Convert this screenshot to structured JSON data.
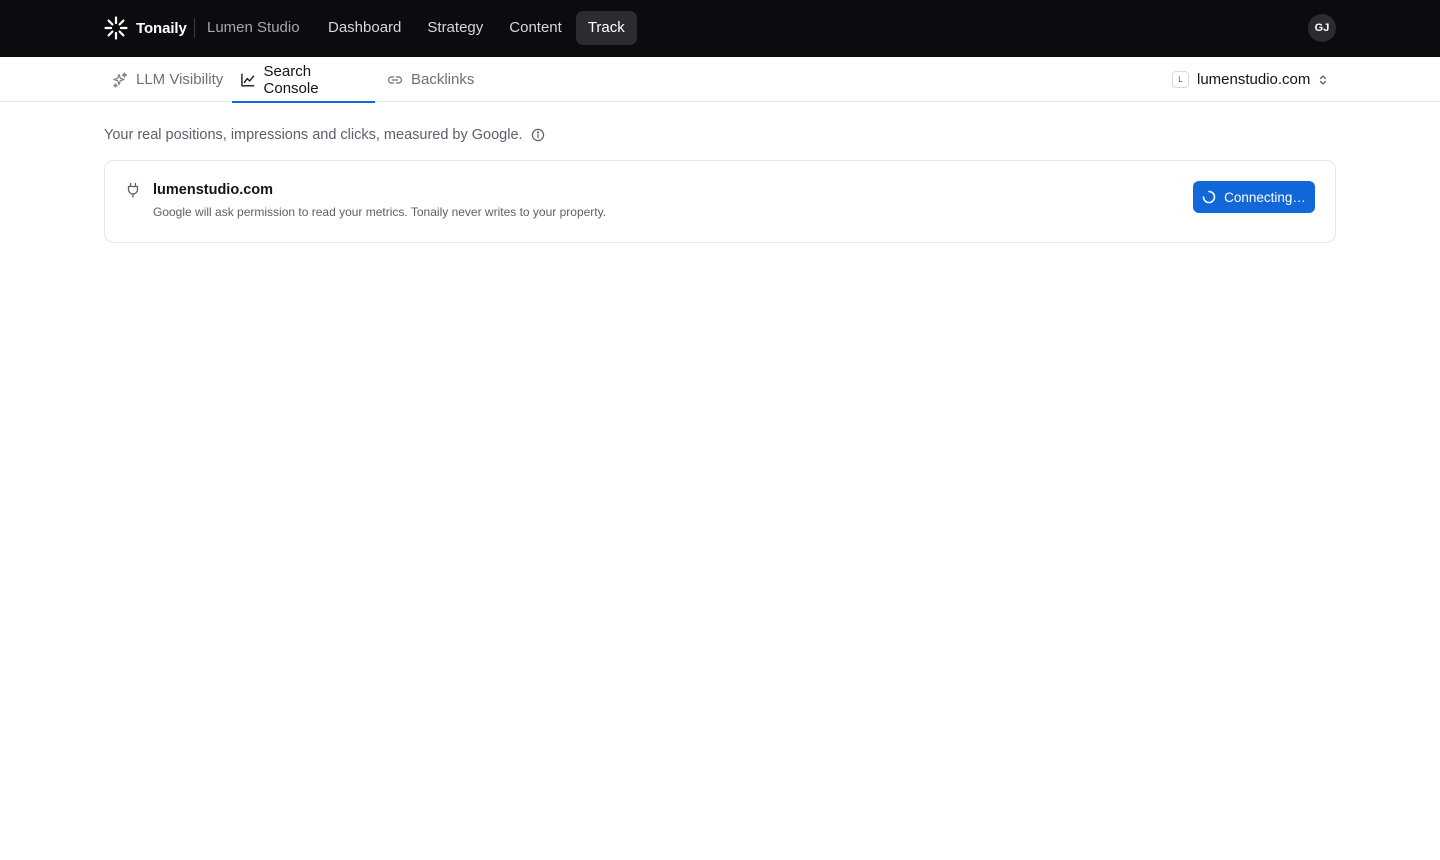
{
  "app": {
    "brand": "Tonaily",
    "workspace": "Lumen Studio",
    "user_initials": "GJ"
  },
  "nav": [
    {
      "label": "Dashboard",
      "active": false
    },
    {
      "label": "Strategy",
      "active": false
    },
    {
      "label": "Content",
      "active": false
    },
    {
      "label": "Track",
      "active": true
    }
  ],
  "subnav": {
    "tabs": [
      {
        "label": "LLM Visibility",
        "icon": "sparkles-icon",
        "active": false
      },
      {
        "label": "Search Console",
        "icon": "line-chart-icon",
        "active": true
      },
      {
        "label": "Backlinks",
        "icon": "link-icon",
        "active": false
      }
    ],
    "site_letter": "L",
    "site_name": "lumenstudio.com"
  },
  "main": {
    "intro": "Your real positions, impressions and clicks, measured by Google.",
    "card": {
      "icon": "plug-icon",
      "title": "lumenstudio.com",
      "description": "Google will ask permission to read your metrics. Tonaily never writes to your property.",
      "button_label": "Connecting…"
    }
  },
  "colors": {
    "topbar_bg": "#0b0c0f",
    "accent": "#1368d9",
    "active_nav_bg": "#2a2c31"
  }
}
